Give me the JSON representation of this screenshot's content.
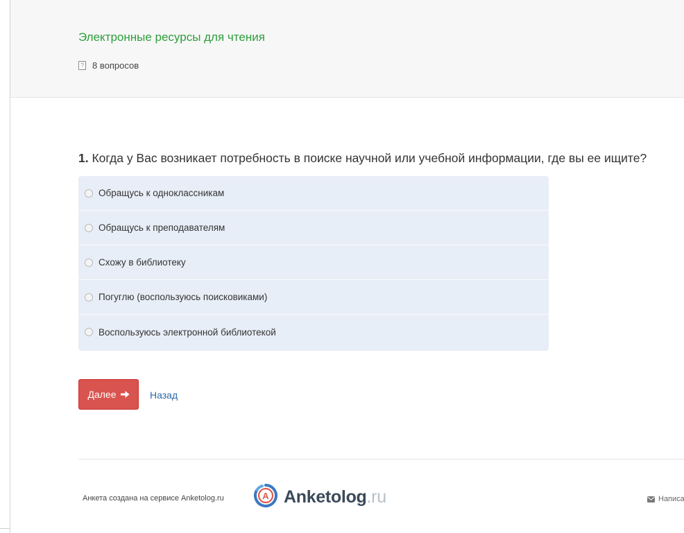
{
  "header": {
    "survey_title": "Электронные ресурсы для чтения",
    "question_count": "8 вопросов",
    "question_icon_glyph": "?"
  },
  "question": {
    "number": "1.",
    "text": "Когда у Вас возникает потребность в поиске научной или учебной информации, где вы ее ищите?",
    "options": [
      {
        "label": "Обращусь к одноклассникам"
      },
      {
        "label": "Обращусь к преподавателям"
      },
      {
        "label": "Схожу в библиотеку"
      },
      {
        "label": "Погуглю (воспользуюсь поисковиками)"
      },
      {
        "label": "Воспользуюсь электронной библиотекой"
      }
    ]
  },
  "nav": {
    "next_label": "Далее",
    "back_label": "Назад"
  },
  "footer": {
    "created_text": "Анкета создана на сервисе Anketolog.ru",
    "logo_letter": "A",
    "logo_name": "Anketolog",
    "logo_tld": ".ru",
    "contact_label": "Написа"
  },
  "colors": {
    "title_green": "#2e9d3c",
    "next_button": "#d9534f",
    "options_bg": "#e8eef7",
    "link_blue": "#2a6aa8"
  },
  "icons": [
    "question-mark-icon",
    "arrow-right-icon",
    "envelope-icon",
    "anketolog-logo-icon"
  ]
}
